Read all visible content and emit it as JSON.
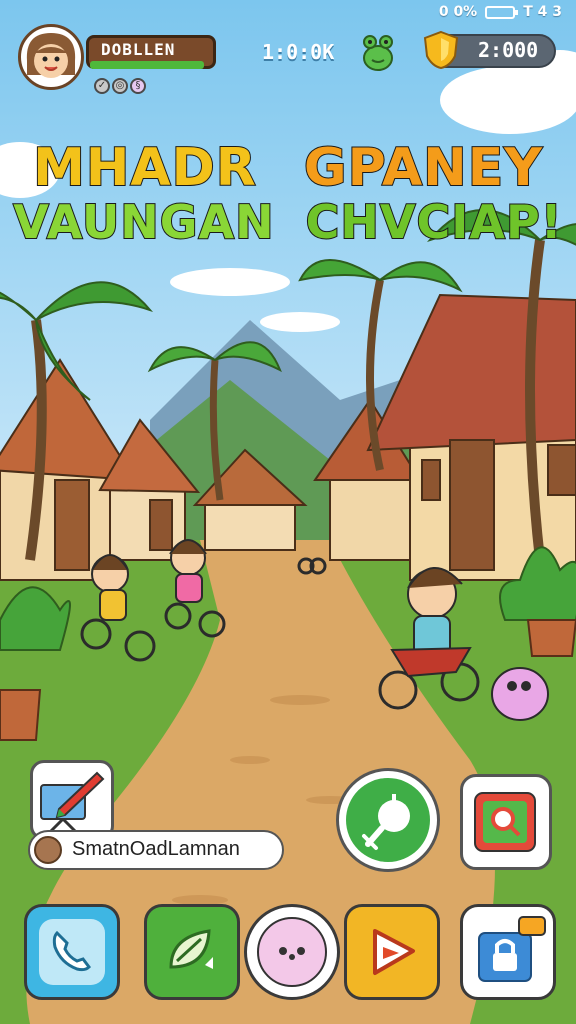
{
  "status": {
    "battery": "0 0%",
    "network": "T 4 3"
  },
  "player": {
    "name": "DOBLLEN",
    "xp_fraction": 0.92,
    "badge_icons": [
      "check-icon",
      "eye-icon",
      "swirl-icon"
    ]
  },
  "hud": {
    "timer": "1:0:0K",
    "coins": "2:000",
    "pet_icon": "frog-icon",
    "coin_icon": "shield-coin-icon"
  },
  "title": {
    "line1_a": "MHADR",
    "line1_b": "GPANEY",
    "line2_a": "VAUNGAN",
    "line2_b": "CHVCIAP!"
  },
  "profile_chip": {
    "label": "SmatnOadLamnan",
    "edit_icon": "pencil-board-icon"
  },
  "action_buttons": {
    "primary_icon": "whistle-icon",
    "secondary_icon": "map-card-icon"
  },
  "dock": [
    {
      "id": "phone",
      "icon": "phone-icon",
      "color": "#3eb6e3"
    },
    {
      "id": "leaf",
      "icon": "leaf-refresh-icon",
      "color": "#4fb03c"
    },
    {
      "id": "pet",
      "icon": "blob-face-icon",
      "color": "#f3c8e8"
    },
    {
      "id": "play",
      "icon": "play-arrow-icon",
      "color": "#f2b625"
    },
    {
      "id": "lock",
      "icon": "chat-lock-icon",
      "color": "#ffffff"
    }
  ]
}
